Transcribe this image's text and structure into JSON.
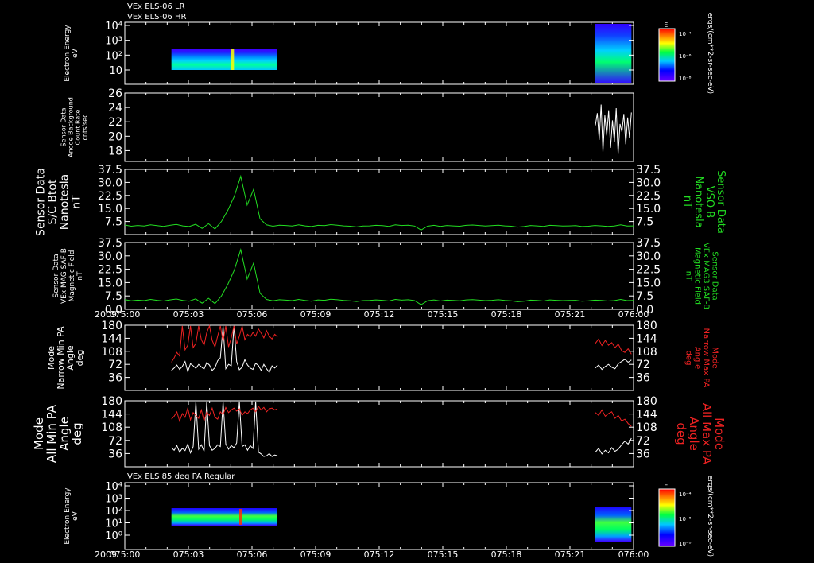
{
  "header": {
    "line1": "VEx ELS-06 LR",
    "line2": "VEx ELS-06 HR"
  },
  "colors": {
    "white": "#ffffff",
    "green": "#22dd22",
    "red": "#ee2222",
    "background": "#000000"
  },
  "chart_data": [
    {
      "id": "p1",
      "type": "heatmap",
      "ylabel": [
        "Electron Energy",
        "eV"
      ],
      "yticks": [
        "10",
        "10²",
        "10³",
        "10⁴"
      ],
      "colorbar": {
        "title": "EI",
        "ticks": [
          "10⁻⁴",
          "10⁻⁶",
          "10⁻⁸"
        ],
        "unit": "ergs/(cm**2-sr-sec-eV)"
      },
      "scale": "log"
    },
    {
      "id": "p2",
      "type": "line",
      "ylabel": [
        "Sensor Data",
        "Anode Background",
        "Count Rate",
        "cnts/sec"
      ],
      "yticks": [
        "18",
        "20",
        "22",
        "24",
        "26"
      ],
      "ylim": [
        16.5,
        26
      ],
      "series": [
        {
          "values": [
            21.5,
            23.2,
            19.5,
            24.4,
            17.8,
            22.9,
            20.1,
            23.6,
            18.4,
            22.2,
            19.2,
            23.9,
            17.5,
            21.7,
            20.6,
            23.1,
            18.9,
            22.6,
            19.8,
            23.3
          ],
          "x_start": 22.2,
          "x_end": 23.9
        }
      ]
    },
    {
      "id": "p3",
      "type": "line",
      "ylabel": [
        "Sensor Data",
        "S/C Btot",
        "Nanotesla",
        "nT"
      ],
      "right_label": [
        "Sensor Data",
        "VSO B",
        "Nanotesla",
        "nT"
      ],
      "yticks": [
        "7.5",
        "15.0",
        "22.5",
        "30.0",
        "37.5"
      ],
      "ylim": [
        0,
        37.5
      ],
      "series": [
        {
          "name": "",
          "values": [
            5.5,
            4.8,
            5.2,
            4.9,
            5.6,
            5.1,
            4.7,
            5.3,
            5.8,
            5.0,
            4.6,
            5.9,
            3.5,
            6.2,
            3.2,
            7.5,
            14.0,
            22.0,
            33.5,
            17.0,
            26.0,
            9.0,
            5.6,
            4.8,
            5.4,
            5.2,
            4.9,
            5.6,
            5.0,
            4.6,
            5.3,
            5.1,
            5.7,
            5.4,
            5.0,
            4.8,
            4.4,
            4.9,
            5.0,
            5.3,
            5.1,
            4.7,
            5.6,
            5.2,
            5.4,
            4.9,
            2.6,
            4.8,
            5.3,
            4.7,
            5.2,
            5.0,
            4.8,
            5.3,
            5.5,
            5.2,
            4.9,
            5.1,
            5.4,
            5.0,
            4.8,
            4.3,
            4.6,
            5.2,
            5.0,
            4.7,
            5.3,
            5.1,
            4.9,
            5.0,
            5.1,
            4.6,
            4.8,
            5.2,
            5.0,
            4.7,
            4.9,
            5.6,
            4.9,
            5.0
          ]
        }
      ]
    },
    {
      "id": "p4",
      "type": "line",
      "ylabel": [
        "Sensor Data",
        "VEx MAG SAF-B",
        "Magnetic Field",
        "nT"
      ],
      "right_label": [
        "Sensor Data",
        "VEx MAG3 SAF-B",
        "Magnetic Field",
        "nT"
      ],
      "yticks": [
        "0.0",
        "7.5",
        "15.0",
        "22.5",
        "30.0",
        "37.5"
      ],
      "ylim": [
        0,
        37.5
      ],
      "series": [
        {
          "name": "",
          "values": [
            5.5,
            4.8,
            5.2,
            4.9,
            5.6,
            5.1,
            4.7,
            5.3,
            5.8,
            5.0,
            4.6,
            5.9,
            3.5,
            6.2,
            3.2,
            7.5,
            14.0,
            22.0,
            33.5,
            17.0,
            26.0,
            9.0,
            5.6,
            4.8,
            5.4,
            5.2,
            4.9,
            5.6,
            5.0,
            4.6,
            5.3,
            5.1,
            5.7,
            5.4,
            5.0,
            4.8,
            4.4,
            4.9,
            5.0,
            5.3,
            5.1,
            4.7,
            5.6,
            5.2,
            5.4,
            4.9,
            2.6,
            4.8,
            5.3,
            4.7,
            5.2,
            5.0,
            4.8,
            5.3,
            5.5,
            5.2,
            4.9,
            5.1,
            5.4,
            5.0,
            4.8,
            4.3,
            4.6,
            5.2,
            5.0,
            4.7,
            5.3,
            5.1,
            4.9,
            5.0,
            5.1,
            4.6,
            4.8,
            5.2,
            5.0,
            4.7,
            4.9,
            5.6,
            4.9,
            5.0
          ]
        }
      ],
      "x_ticks": [
        "075:00",
        "075:03",
        "075:06",
        "075:09",
        "075:12",
        "075:15",
        "075:18",
        "075:21",
        "076:00"
      ],
      "year": "2009"
    },
    {
      "id": "p5",
      "type": "line",
      "ylabel": [
        "Mode",
        "Narrow Min PA",
        "Angle",
        "deg"
      ],
      "right_label": [
        "Mode",
        "Narrow Max PA",
        "Angle",
        "deg"
      ],
      "yticks": [
        "36",
        "72",
        "108",
        "144",
        "180"
      ],
      "ylim": [
        0,
        180
      ],
      "series": [
        {
          "values": [
            55,
            62,
            70,
            58,
            66,
            80,
            52,
            74,
            68,
            61,
            72,
            65,
            59,
            77,
            70,
            55,
            63,
            82,
            90,
            178,
            60,
            72,
            68,
            178,
            80,
            57,
            64,
            85,
            70,
            62,
            58,
            75,
            69,
            55,
            72,
            60,
            50,
            68,
            62,
            70
          ],
          "x_start": 2.2,
          "x_end": 7.2
        },
        {
          "values": [
            78,
            90,
            105,
            95,
            178,
            112,
            125,
            178,
            118,
            130,
            178,
            140,
            125,
            160,
            178,
            138,
            120,
            150,
            178,
            135,
            178,
            120,
            145,
            178,
            128,
            150,
            178,
            140,
            155,
            148,
            160,
            150,
            170,
            158,
            145,
            165,
            150,
            142,
            155,
            148
          ],
          "x_start": 2.2,
          "x_end": 7.2
        },
        {
          "values": [
            62,
            70,
            58,
            66,
            72,
            64,
            60,
            74,
            80,
            86,
            78,
            84
          ],
          "x_start": 22.2,
          "x_end": 23.9
        },
        {
          "values": [
            130,
            142,
            124,
            138,
            125,
            132,
            118,
            128,
            110,
            105,
            115,
            100
          ],
          "x_start": 22.2,
          "x_end": 23.9
        }
      ]
    },
    {
      "id": "p6",
      "type": "line",
      "ylabel": [
        "Mode",
        "All Min PA",
        "Angle",
        "deg"
      ],
      "right_label": [
        "Mode",
        "All Max PA",
        "Angle",
        "deg"
      ],
      "yticks": [
        "36",
        "72",
        "108",
        "144",
        "180"
      ],
      "ylim": [
        0,
        180
      ],
      "series": [
        {
          "values": [
            52,
            45,
            58,
            40,
            50,
            44,
            62,
            38,
            55,
            178,
            48,
            60,
            42,
            178,
            58,
            45,
            50,
            60,
            55,
            178,
            62,
            48,
            58,
            52,
            65,
            178,
            55,
            60,
            45,
            58,
            50,
            178,
            40,
            35,
            28,
            30,
            36,
            28,
            32,
            30
          ],
          "x_start": 2.2,
          "x_end": 7.2
        },
        {
          "values": [
            130,
            138,
            150,
            125,
            145,
            135,
            160,
            128,
            148,
            140,
            132,
            155,
            125,
            150,
            140,
            160,
            135,
            130,
            150,
            142,
            162,
            148,
            155,
            160,
            152,
            158,
            140,
            150,
            145,
            155,
            160,
            150,
            165,
            155,
            162,
            150,
            158,
            160,
            155,
            158
          ],
          "x_start": 2.2,
          "x_end": 7.2
        },
        {
          "values": [
            40,
            50,
            35,
            45,
            38,
            52,
            42,
            48,
            60,
            70,
            62,
            78
          ],
          "x_start": 22.2,
          "x_end": 23.9
        },
        {
          "values": [
            148,
            140,
            155,
            138,
            145,
            150,
            132,
            140,
            125,
            130,
            118,
            110
          ],
          "x_start": 22.2,
          "x_end": 23.9
        }
      ]
    },
    {
      "id": "p7",
      "type": "heatmap",
      "title": "VEx ELS 85 deg PA Regular",
      "ylabel": [
        "Electron Energy",
        "eV"
      ],
      "yticks": [
        "10⁰",
        "10¹",
        "10²",
        "10³",
        "10⁴"
      ],
      "colorbar": {
        "title": "EI",
        "ticks": [
          "10⁻⁴",
          "10⁻⁶",
          "10⁻⁸"
        ],
        "unit": "ergs/(cm**2-sr-sec-eV)"
      },
      "x_ticks": [
        "075:00",
        "075:03",
        "075:06",
        "075:09",
        "075:12",
        "075:15",
        "075:18",
        "075:21",
        "076:00"
      ],
      "year": "2009",
      "scale": "log"
    }
  ]
}
